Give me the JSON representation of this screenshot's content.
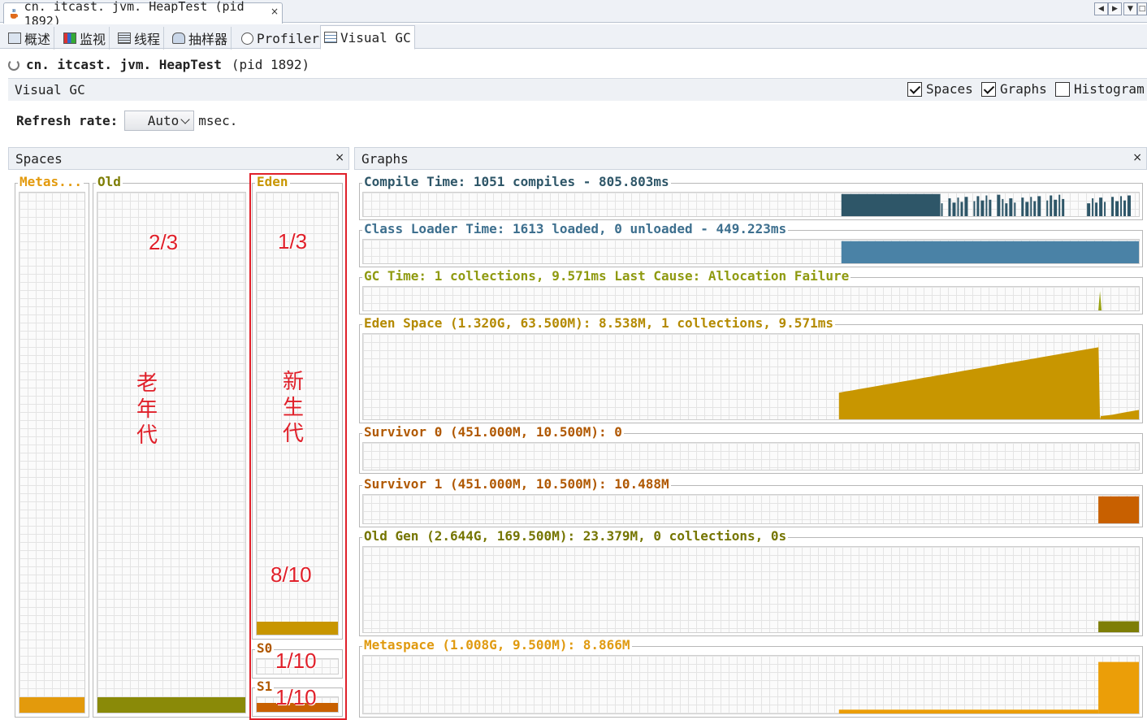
{
  "document_tab": {
    "title": "cn. itcast. jvm. HeapTest  (pid 1892)",
    "close": "×"
  },
  "window_controls": [
    "◀",
    "▶",
    "▼",
    "□"
  ],
  "feature_tabs": [
    {
      "label": "概述",
      "icon": "overview-icon"
    },
    {
      "label": "监视",
      "icon": "monitor-icon"
    },
    {
      "label": "线程",
      "icon": "threads-icon"
    },
    {
      "label": "抽样器",
      "icon": "sampler-icon"
    },
    {
      "label": "Profiler",
      "icon": "profiler-icon"
    },
    {
      "label": "Visual  GC",
      "icon": "visualgc-icon",
      "active": true
    }
  ],
  "process": {
    "name": "cn. itcast. jvm. HeapTest",
    "pid": "(pid 1892)"
  },
  "visual_gc": {
    "title": "Visual  GC",
    "options": [
      {
        "label": "Spaces",
        "checked": true
      },
      {
        "label": "Graphs",
        "checked": true
      },
      {
        "label": "Histogram",
        "checked": false
      }
    ]
  },
  "refresh": {
    "label": "Refresh rate:",
    "value": "Auto",
    "unit": "msec."
  },
  "spaces_panel": {
    "title": "Spaces",
    "close": "×",
    "columns": [
      {
        "label": "Metas...",
        "color": "#e39a0c",
        "fill": 0.01
      },
      {
        "label": "Old",
        "color": "#8a8a08",
        "fill": 0.01
      },
      {
        "label": "Eden",
        "color": "#c89600",
        "fill": 0.006
      },
      {
        "label": "S0",
        "color": "#c86000",
        "fill": 0
      },
      {
        "label": "S1",
        "color": "#c86000",
        "fill": 0.62
      }
    ]
  },
  "graphs_panel": {
    "title": "Graphs",
    "close": "×",
    "rows": [
      {
        "label": "Compile Time: 1051 compiles - 805.803ms",
        "color": "#2e5668",
        "label_color": "#2e5668"
      },
      {
        "label": "Class Loader Time: 1613 loaded, 0 unloaded - 449.223ms",
        "color": "#4a82a6",
        "label_color": "#3d6f8e"
      },
      {
        "label": "GC Time: 1 collections, 9.571ms Last Cause: Allocation Failure",
        "color": "#9aa312",
        "label_color": "#8f9a10"
      },
      {
        "label": "Eden Space (1.320G, 63.500M): 8.538M, 1 collections, 9.571ms",
        "color": "#c89600",
        "label_color": "#b48a00"
      },
      {
        "label": "Survivor 0 (451.000M, 10.500M): 0",
        "color": "#c86000",
        "label_color": "#b05800"
      },
      {
        "label": "Survivor 1 (451.000M, 10.500M): 10.488M",
        "color": "#c86000",
        "label_color": "#b05800"
      },
      {
        "label": "Old Gen (2.644G, 169.500M): 23.379M, 0 collections, 0s",
        "color": "#7e7e06",
        "label_color": "#757500"
      },
      {
        "label": "Metaspace (1.008G, 9.500M): 8.866M",
        "color": "#eb9e08",
        "label_color": "#e09a10"
      }
    ]
  },
  "annotations": {
    "old_ratio": "2/3",
    "young_ratio": "1/3",
    "old_gen_cn": [
      "老",
      "年",
      "代"
    ],
    "young_gen_cn": [
      "新",
      "生",
      "代"
    ],
    "eden_ratio": "8/10",
    "s0_ratio": "1/10",
    "s1_ratio": "1/10"
  }
}
